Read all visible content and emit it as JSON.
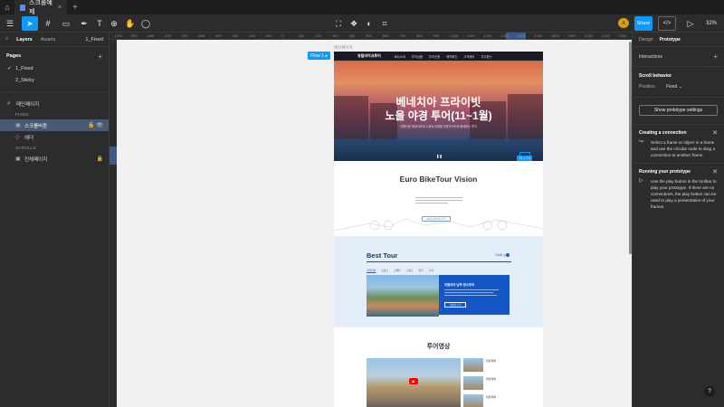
{
  "titlebar": {
    "tab_label": "스크롤예제"
  },
  "toolbar": {
    "share_label": "Share",
    "zoom": "32%",
    "avatar_initials": "A",
    "tools": [
      "menu-icon",
      "move-icon",
      "frame-icon",
      "pen-icon",
      "text-icon",
      "hand-icon",
      "comment-icon"
    ]
  },
  "left_panel": {
    "tabs": {
      "layers": "Layers",
      "assets": "Assets",
      "page_selector": "1_Fixed"
    },
    "pages_heading": "Pages",
    "pages": [
      "1_Fixed",
      "2_Sticky"
    ],
    "layers": {
      "frame_name": "메인페이지",
      "group_fixed": "FIXED",
      "fixed_items": [
        "스크롤버튼",
        "헤더"
      ],
      "group_scrolls": "SCROLLS",
      "scroll_items": [
        "전체페이지"
      ]
    }
  },
  "rulers": {
    "top_ticks": [
      "-1000",
      "-900",
      "-800",
      "-700",
      "-600",
      "-500",
      "-400",
      "-300",
      "-200",
      "-100",
      "0",
      "100",
      "200",
      "300",
      "400",
      "500",
      "600",
      "700",
      "800",
      "900",
      "1000",
      "1100",
      "1200",
      "1340",
      "1601",
      "1700",
      "1800",
      "1900",
      "2000",
      "2100",
      "2200"
    ]
  },
  "canvas": {
    "frame_label": "메인페이지",
    "flow_label": "Flow 1",
    "site": {
      "nav_logo": "유럽바이크투어",
      "nav_items": [
        "회사소개",
        "투어상품",
        "투어신청",
        "예약확인",
        "고객센터",
        "자주묻는"
      ],
      "hero_title_1": "베네치아 프라이빗",
      "hero_title_2": "노을 야경 투어(11~1월)",
      "hero_sub": "아름다운 베네치아의 노을과 야경을 전문가이드와 함께하는 투어",
      "size_badge": "71 × 71",
      "vision_title": "Euro BikeTour Vision",
      "vision_button": "회사소개 바로가기",
      "best_title": "Best Tour",
      "best_more": "자세히 보기",
      "best_tabs": [
        "이탈리아",
        "프랑스",
        "스페인",
        "스위스",
        "영국",
        "기타"
      ],
      "best_card_title": "이탈리아 남부 명소투어",
      "best_card_button": "자세히 보기",
      "video_title": "투어영상",
      "video_items": [
        "영상제목",
        "영상제목",
        "영상제목"
      ]
    }
  },
  "right_panel": {
    "tabs": {
      "design": "Design",
      "prototype": "Prototype"
    },
    "interactions": "Interactions",
    "scroll_behavior": "Scroll behavior",
    "position_label": "Position",
    "position_value": "Fixed",
    "settings_button": "Show prototype settings",
    "creating_title": "Creating a connection",
    "creating_body": "Select a frame or object in a frame and use the circular node to drag a connection to another frame.",
    "running_title": "Running your prototype",
    "running_body": "Use the play button in the toolbar to play your prototype. If there are no connections, the play button can be used to play a presentation of your frames."
  },
  "help_label": "?"
}
